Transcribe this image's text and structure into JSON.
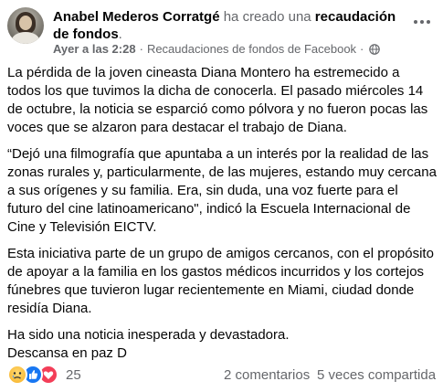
{
  "post": {
    "author": "Anabel Mederos Corratgé",
    "action": " ha creado una ",
    "fundraiser_label": "recaudación de fondos",
    "period": ".",
    "timestamp": "Ayer a las 2:28",
    "separator": "·",
    "source": "Recaudaciones de fondos de Facebook",
    "separator2": "·",
    "privacy_icon": "globe-icon",
    "more_icon": "more-options-icon"
  },
  "body": {
    "paragraphs": [
      "La pérdida de la joven cineasta Diana Montero ha estremecido a todos los que tuvimos la dicha de conocerla. El pasado miércoles 14 de octubre, la noticia se esparció como pólvora y no fueron pocas las voces que se alzaron para destacar el trabajo de Diana.",
      "“Dejó una filmografía que apuntaba a un interés por la realidad de las zonas rurales y, particularmente, de las mujeres, estando muy cercana a sus orígenes y su familia. Era, sin duda, una voz fuerte para el futuro del cine latinoamericano\", indicó la Escuela Internacional de Cine y Televisión EICTV.",
      "Esta iniciativa parte de un grupo de amigos cercanos, con el propósito de apoyar a la familia en los gastos médicos incurridos y los cortejos fúnebres que tuvieron lugar recientemente en Miami, ciudad donde residía Diana."
    ],
    "closing_line_1": "Ha sido una noticia inesperada y devastadora.",
    "closing_line_2": "Descansa en paz D"
  },
  "footer": {
    "reaction_icons": [
      "sad-reaction-icon",
      "like-reaction-icon",
      "love-reaction-icon"
    ],
    "reaction_count": "25",
    "comments": "2 comentarios",
    "shares": "5 veces compartida"
  },
  "colors": {
    "text": "#050505",
    "secondary": "#65676b",
    "like_blue": "#1877f2",
    "love_red": "#f33e58",
    "sad_yellow": "#f7b125"
  }
}
